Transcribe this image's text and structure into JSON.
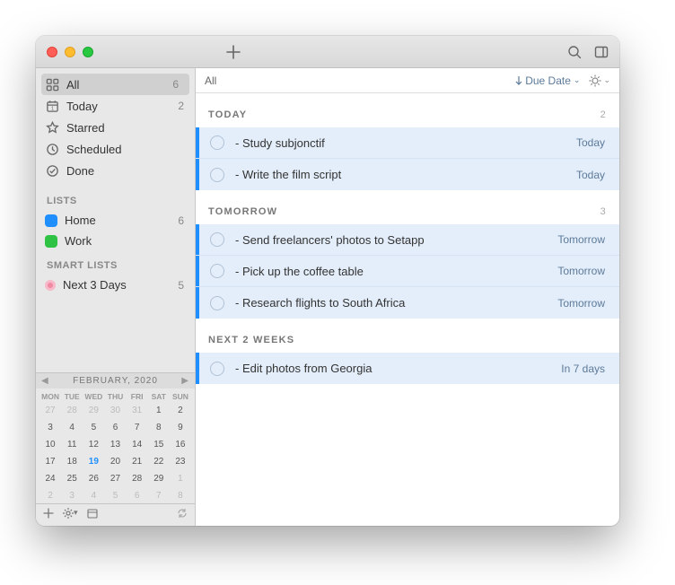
{
  "titlebar": {},
  "sidebar": {
    "smart": [
      {
        "icon": "grid",
        "label": "All",
        "count": "6"
      },
      {
        "icon": "calendar",
        "label": "Today",
        "count": "2"
      },
      {
        "icon": "star",
        "label": "Starred",
        "count": ""
      },
      {
        "icon": "clock",
        "label": "Scheduled",
        "count": ""
      },
      {
        "icon": "check",
        "label": "Done",
        "count": ""
      }
    ],
    "lists_header": "LISTS",
    "lists": [
      {
        "color": "blue",
        "label": "Home",
        "count": "6"
      },
      {
        "color": "green",
        "label": "Work",
        "count": ""
      }
    ],
    "smartlists_header": "SMART LISTS",
    "smartlists": [
      {
        "color": "pink",
        "label": "Next 3 Days",
        "count": "5"
      }
    ]
  },
  "calendar": {
    "title": "FEBRUARY, 2020",
    "dow": [
      "MON",
      "TUE",
      "WED",
      "THU",
      "FRI",
      "SAT",
      "SUN"
    ],
    "rows": [
      [
        {
          "n": "27",
          "d": 1
        },
        {
          "n": "28",
          "d": 1
        },
        {
          "n": "29",
          "d": 1
        },
        {
          "n": "30",
          "d": 1
        },
        {
          "n": "31",
          "d": 1
        },
        {
          "n": "1",
          "d": 0
        },
        {
          "n": "2",
          "d": 0
        }
      ],
      [
        {
          "n": "3"
        },
        {
          "n": "4"
        },
        {
          "n": "5"
        },
        {
          "n": "6"
        },
        {
          "n": "7"
        },
        {
          "n": "8"
        },
        {
          "n": "9"
        }
      ],
      [
        {
          "n": "10"
        },
        {
          "n": "11"
        },
        {
          "n": "12"
        },
        {
          "n": "13"
        },
        {
          "n": "14"
        },
        {
          "n": "15"
        },
        {
          "n": "16"
        }
      ],
      [
        {
          "n": "17"
        },
        {
          "n": "18"
        },
        {
          "n": "19",
          "t": 1
        },
        {
          "n": "20"
        },
        {
          "n": "21"
        },
        {
          "n": "22"
        },
        {
          "n": "23"
        }
      ],
      [
        {
          "n": "24"
        },
        {
          "n": "25"
        },
        {
          "n": "26"
        },
        {
          "n": "27"
        },
        {
          "n": "28"
        },
        {
          "n": "29"
        },
        {
          "n": "1",
          "d": 1
        }
      ],
      [
        {
          "n": "2",
          "d": 1
        },
        {
          "n": "3",
          "d": 1
        },
        {
          "n": "4",
          "d": 1
        },
        {
          "n": "5",
          "d": 1
        },
        {
          "n": "6",
          "d": 1
        },
        {
          "n": "7",
          "d": 1
        },
        {
          "n": "8",
          "d": 1
        }
      ]
    ]
  },
  "main": {
    "title": "All",
    "sort_label": "Due Date",
    "sections": [
      {
        "title": "TODAY",
        "count": "2",
        "tasks": [
          {
            "text": "- Study subjonctif",
            "due": "Today"
          },
          {
            "text": "- Write the film script",
            "due": "Today"
          }
        ]
      },
      {
        "title": "TOMORROW",
        "count": "3",
        "tasks": [
          {
            "text": "- Send freelancers' photos to Setapp",
            "due": "Tomorrow"
          },
          {
            "text": "- Pick up the coffee table",
            "due": "Tomorrow"
          },
          {
            "text": "- Research flights to South Africa",
            "due": "Tomorrow"
          }
        ]
      },
      {
        "title": "NEXT 2 WEEKS",
        "count": "",
        "tasks": [
          {
            "text": "- Edit photos from Georgia",
            "due": "In 7 days"
          }
        ]
      }
    ]
  }
}
